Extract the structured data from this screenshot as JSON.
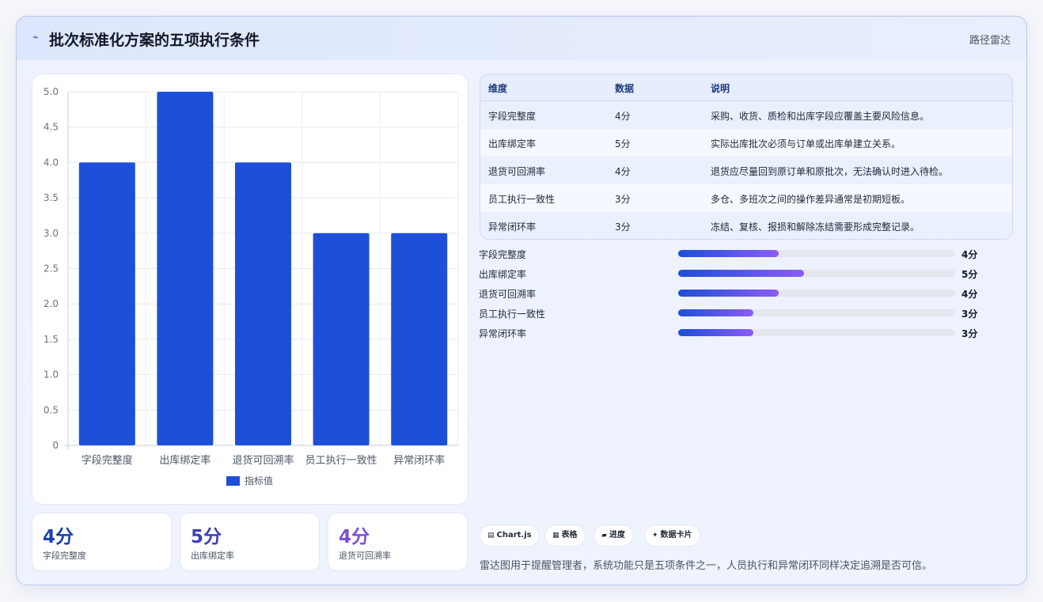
{
  "header": {
    "icon": "activity-icon",
    "title": "批次标准化方案的五项执行条件",
    "tag": "路径雷达"
  },
  "chart_data": {
    "type": "bar",
    "categories": [
      "字段完整度",
      "出库绑定率",
      "退货可回溯率",
      "员工执行一致性",
      "异常闭环率"
    ],
    "series": [
      {
        "name": "指标值",
        "values": [
          4,
          5,
          4,
          3,
          3
        ],
        "color": "#1d4fd8"
      }
    ],
    "title": "",
    "xlabel": "",
    "ylabel": "",
    "ylim": [
      0,
      5
    ],
    "yticks": [
      "0",
      "0.5",
      "1.0",
      "1.5",
      "2.0",
      "2.5",
      "3.0",
      "3.5",
      "4.0",
      "4.5",
      "5.0"
    ],
    "grid": true,
    "legend": "bottom"
  },
  "kpis": [
    {
      "value": "4分",
      "label": "字段完整度",
      "color": "#1e3fae"
    },
    {
      "value": "5分",
      "label": "出库绑定率",
      "color": "#3b3fbf"
    },
    {
      "value": "4分",
      "label": "退货可回溯率",
      "color": "#7c4fd8"
    }
  ],
  "table": {
    "headers": [
      "维度",
      "数据",
      "说明"
    ],
    "rows": [
      [
        "字段完整度",
        "4分",
        "采购、收货、质检和出库字段应覆盖主要风险信息。"
      ],
      [
        "出库绑定率",
        "5分",
        "实际出库批次必须与订单或出库单建立关系。"
      ],
      [
        "退货可回溯率",
        "4分",
        "退货应尽量回到原订单和原批次，无法确认时进入待检。"
      ],
      [
        "员工执行一致性",
        "3分",
        "多仓、多班次之间的操作差异通常是初期短板。"
      ],
      [
        "异常闭环率",
        "3分",
        "冻结、复核、报损和解除冻结需要形成完整记录。"
      ]
    ]
  },
  "progress": {
    "max": 11,
    "items": [
      {
        "label": "字段完整度",
        "value": 4,
        "text": "4分"
      },
      {
        "label": "出库绑定率",
        "value": 5,
        "text": "5分"
      },
      {
        "label": "退货可回溯率",
        "value": 4,
        "text": "4分"
      },
      {
        "label": "员工执行一致性",
        "value": 3,
        "text": "3分"
      },
      {
        "label": "异常闭环率",
        "value": 3,
        "text": "3分"
      }
    ]
  },
  "chips": [
    {
      "icon": "chart-icon",
      "glyph": "▤",
      "label": "Chart.js"
    },
    {
      "icon": "table-icon",
      "glyph": "▦",
      "label": "表格"
    },
    {
      "icon": "progress-icon",
      "glyph": "▰",
      "label": "进度"
    },
    {
      "icon": "sparkle-icon",
      "glyph": "✦",
      "label": "数据卡片"
    }
  ],
  "footnote": "雷达图用于提醒管理者，系统功能只是五项条件之一，人员执行和异常闭环同样决定追溯是否可信。"
}
